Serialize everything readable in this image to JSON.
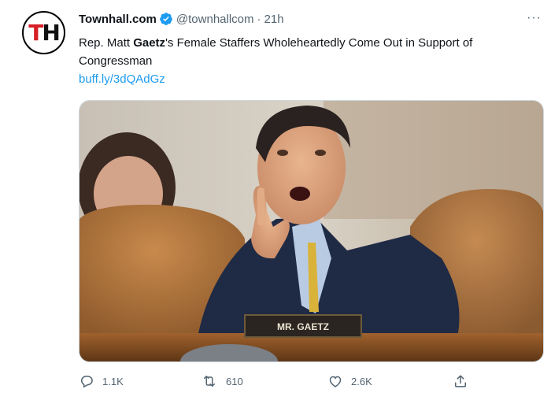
{
  "tweet": {
    "avatar_logo": {
      "left": "T",
      "right": "H"
    },
    "display_name": "Townhall.com",
    "handle": "@townhallcom",
    "separator": "·",
    "time": "21h",
    "more_label": "···",
    "text": {
      "prefix": "Rep. Matt ",
      "bold": "Gaetz",
      "suffix": "'s Female Staffers Wholeheartedly Come Out in Support of Congressman"
    },
    "link": "buff.ly/3dQAdGz",
    "photo": {
      "nameplate": "MR. GAETZ"
    },
    "actions": {
      "replies": "1.1K",
      "retweets": "610",
      "likes": "2.6K"
    }
  },
  "colors": {
    "accent": "#1d9bf0",
    "muted": "#536471",
    "text": "#0f1419",
    "logo_red": "#d61f26"
  },
  "icons": [
    "verified-badge-icon",
    "more-icon",
    "reply-icon",
    "retweet-icon",
    "like-icon",
    "share-icon"
  ]
}
